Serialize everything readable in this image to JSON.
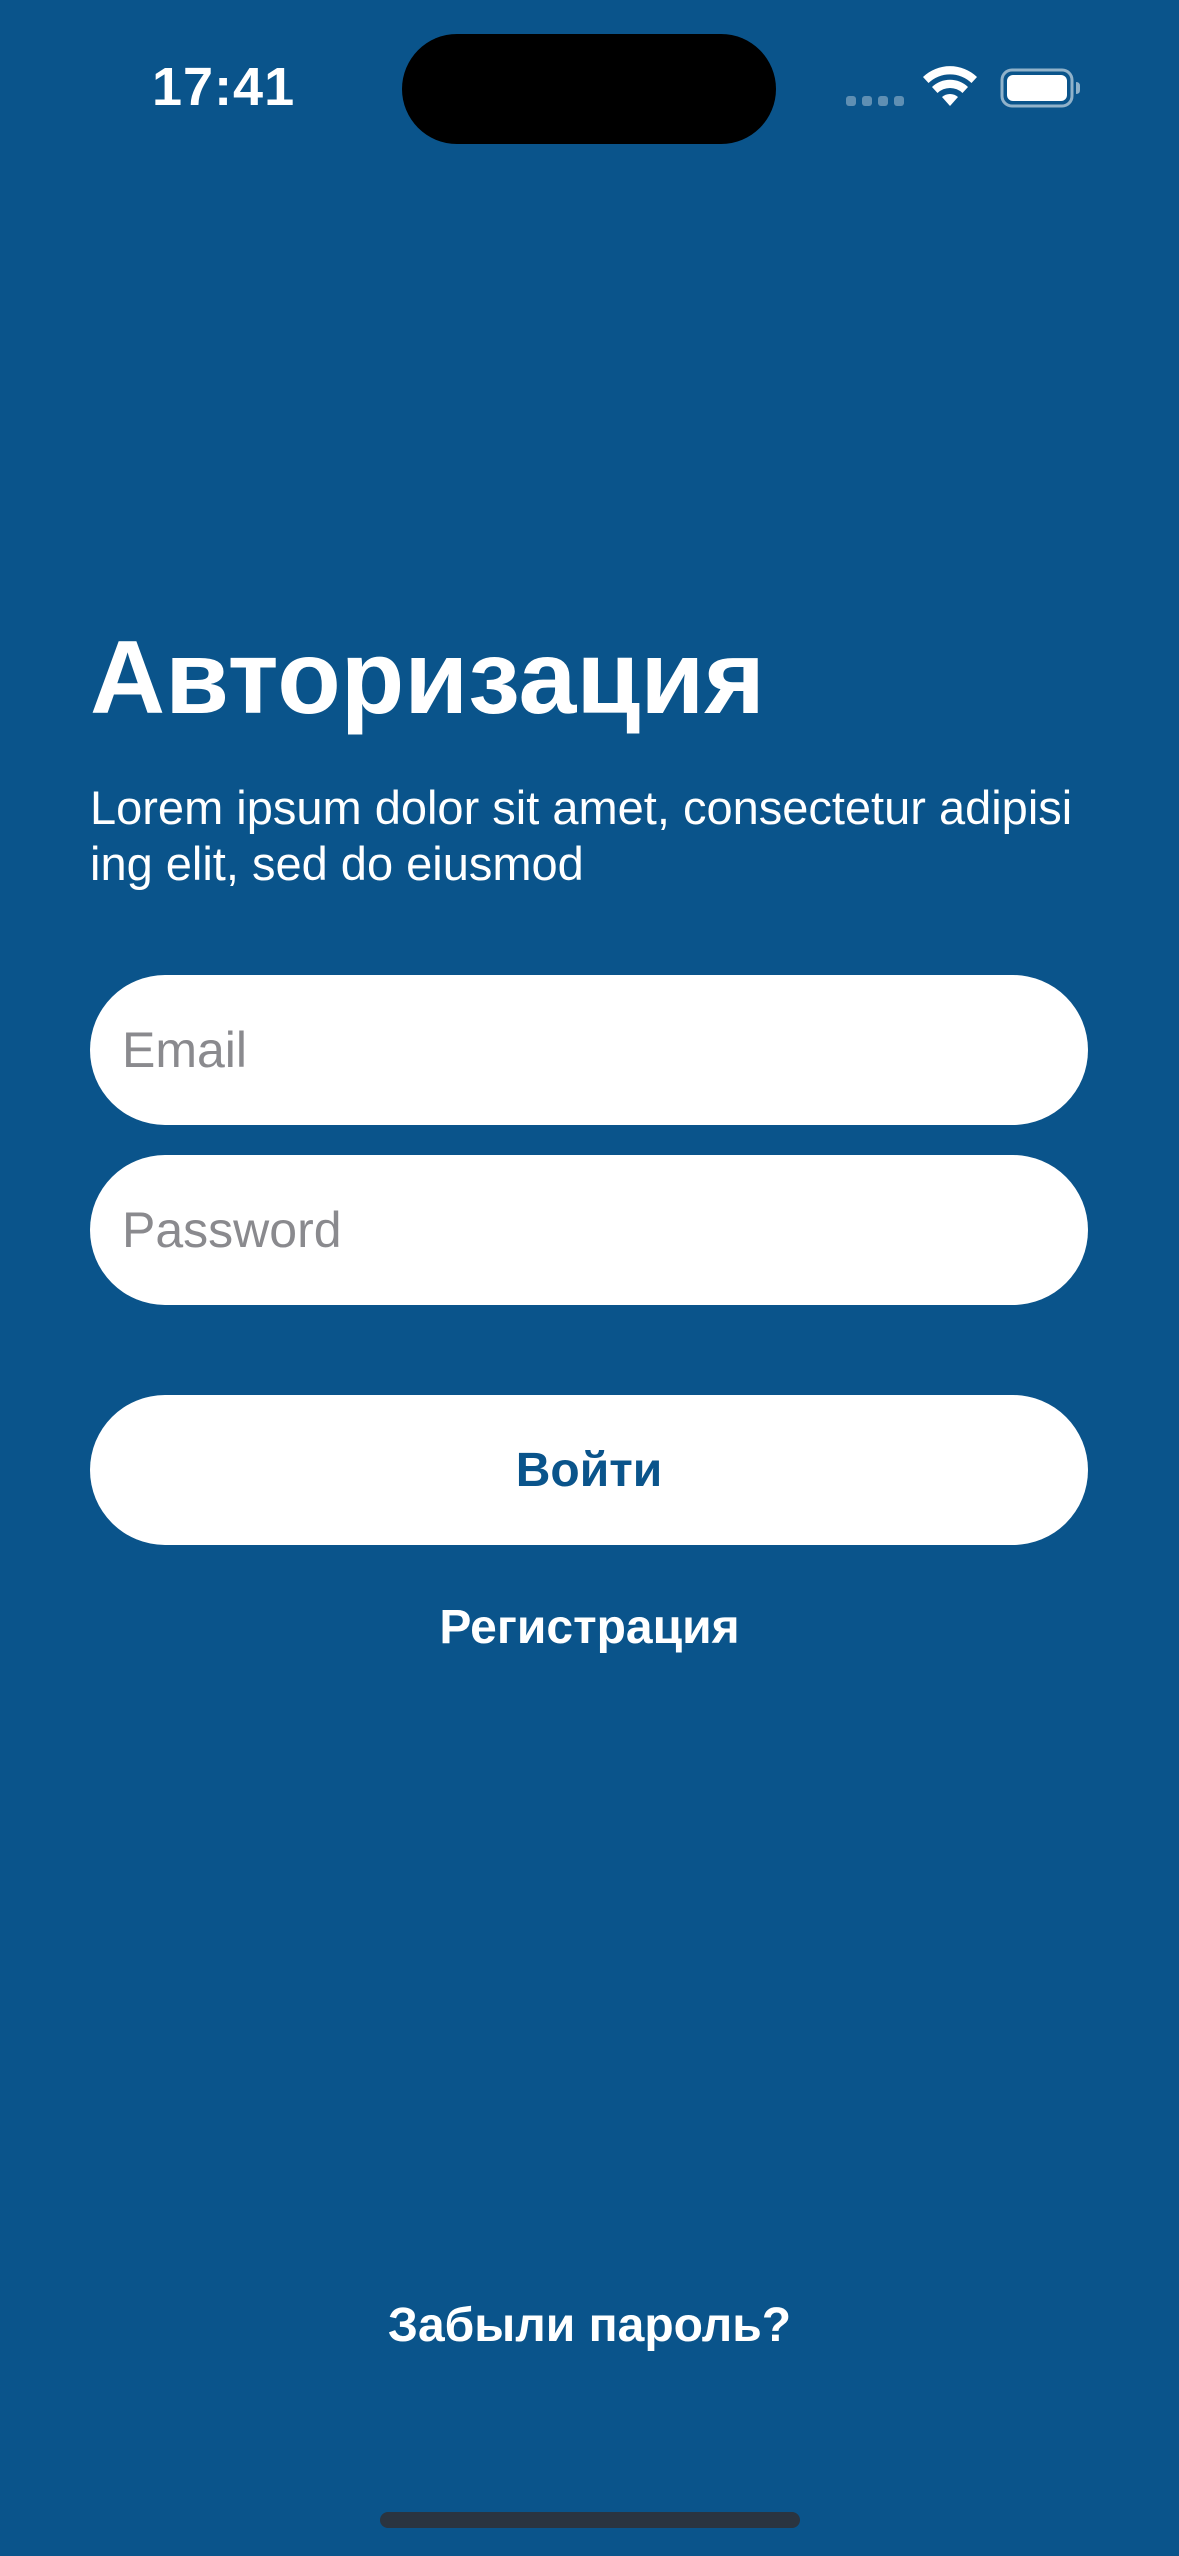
{
  "status_bar": {
    "time": "17:41"
  },
  "auth": {
    "title": "Авторизация",
    "subtitle": "Lorem ipsum dolor sit amet, consectetur adipisi ing elit, sed do eiusmod",
    "email_placeholder": "Email",
    "email_value": "",
    "password_placeholder": "Password",
    "password_value": "",
    "login_label": "Войти",
    "register_label": "Регистрация",
    "forgot_label": "Забыли пароль?"
  },
  "colors": {
    "background": "#0a548b",
    "button_text": "#0a548b",
    "field_background": "#ffffff",
    "placeholder": "#8a8a8e"
  },
  "icons": {
    "wifi": "wifi-icon",
    "battery": "battery-icon",
    "signal": "cellular-signal-icon"
  }
}
